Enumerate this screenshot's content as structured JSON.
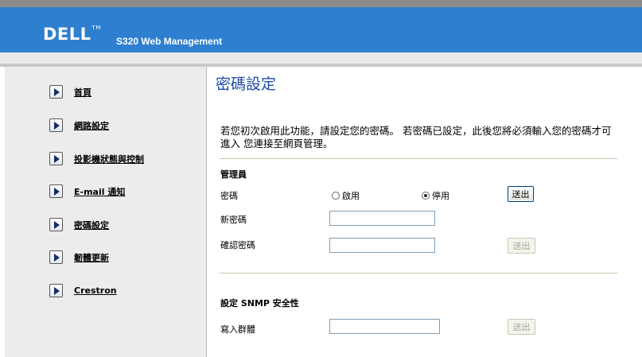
{
  "header": {
    "logo": "DELL",
    "logo_tm": "TM",
    "title": "S320 Web Management"
  },
  "sidebar": {
    "items": [
      {
        "label": "首頁"
      },
      {
        "label": "網路設定"
      },
      {
        "label": "投影機狀態與控制"
      },
      {
        "label": "E-mail 通知"
      },
      {
        "label": "密碼設定"
      },
      {
        "label": "韌體更新"
      },
      {
        "label": "Crestron"
      }
    ]
  },
  "main": {
    "title": "密碼設定",
    "intro": "若您初次啟用此功能，請設定您的密碼。 若密碼已設定，此後您將必須輸入您的密碼才可進入 您連接至網頁管理。",
    "admin": {
      "section_title": "管理員",
      "password_label": "密碼",
      "enable_label": "啟用",
      "disable_label": "停用",
      "selected": "disable",
      "submit_label": "送出",
      "new_password_label": "新密碼",
      "new_password_value": "",
      "confirm_password_label": "確認密碼",
      "confirm_password_value": "",
      "confirm_submit_label": "送出"
    },
    "snmp": {
      "section_title": "設定 SNMP 安全性",
      "community_label": "寫入群體",
      "community_value": "",
      "submit_label": "送出"
    }
  },
  "colors": {
    "header_blue": "#2e7fcf",
    "title_blue": "#1f4aa8",
    "sidebar_bg": "#ececec"
  }
}
